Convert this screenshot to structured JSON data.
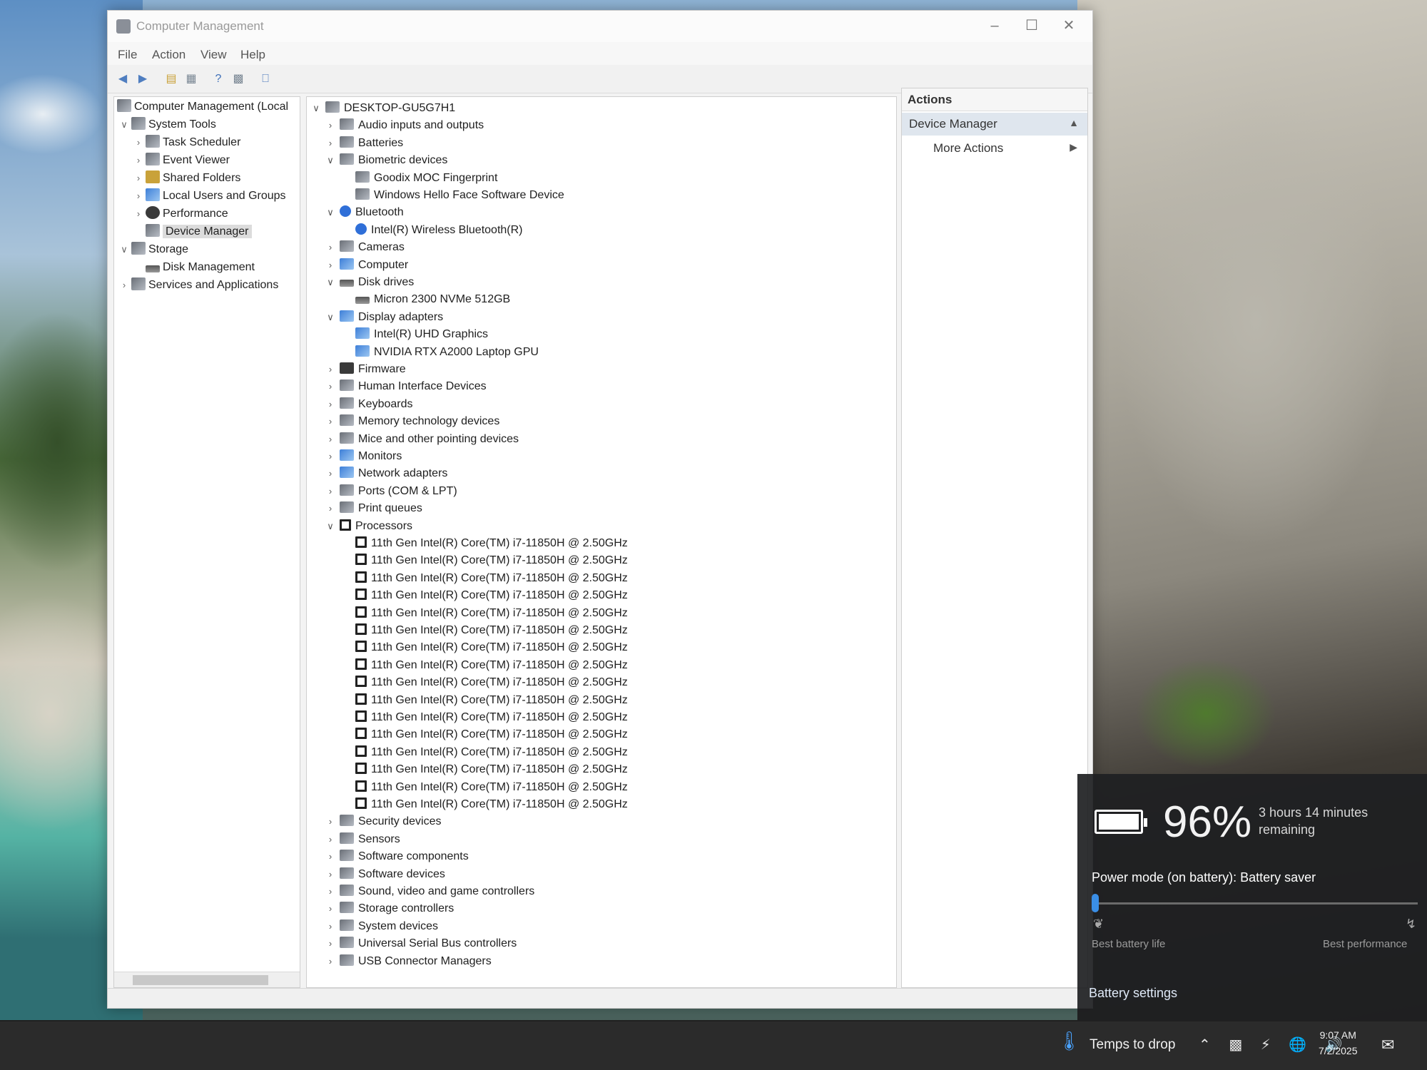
{
  "window": {
    "title": "Computer Management",
    "menu": [
      "File",
      "Action",
      "View",
      "Help"
    ]
  },
  "left_tree": [
    {
      "label": "Computer Management (Local",
      "expanded": true,
      "selected": false
    },
    {
      "label": "System Tools",
      "expanded": true,
      "selected": false
    },
    {
      "label": "Task Scheduler",
      "expanded": false,
      "selected": false
    },
    {
      "label": "Event Viewer",
      "expanded": false,
      "selected": false
    },
    {
      "label": "Shared Folders",
      "expanded": false,
      "selected": false
    },
    {
      "label": "Local Users and Groups",
      "expanded": false,
      "selected": false
    },
    {
      "label": "Performance",
      "expanded": false,
      "selected": false
    },
    {
      "label": "Device Manager",
      "expanded": false,
      "selected": true
    },
    {
      "label": "Storage",
      "expanded": true,
      "selected": false
    },
    {
      "label": "Disk Management",
      "expanded": false,
      "selected": false
    },
    {
      "label": "Services and Applications",
      "expanded": false,
      "selected": false
    }
  ],
  "device_tree": {
    "root": "DESKTOP-GU5G7H1",
    "categories": [
      {
        "label": "Audio inputs and outputs",
        "expanded": false,
        "icon": "speaker-icon",
        "children": []
      },
      {
        "label": "Batteries",
        "expanded": false,
        "icon": "battery-icon",
        "children": []
      },
      {
        "label": "Biometric devices",
        "expanded": true,
        "icon": "fingerprint-icon",
        "children": [
          "Goodix MOC Fingerprint",
          "Windows Hello Face Software Device"
        ]
      },
      {
        "label": "Bluetooth",
        "expanded": true,
        "icon": "bluetooth-icon",
        "children": [
          "Intel(R) Wireless Bluetooth(R)"
        ]
      },
      {
        "label": "Cameras",
        "expanded": false,
        "icon": "camera-icon",
        "children": []
      },
      {
        "label": "Computer",
        "expanded": false,
        "icon": "monitor-icon",
        "children": []
      },
      {
        "label": "Disk drives",
        "expanded": true,
        "icon": "disk-icon",
        "children": [
          "Micron 2300 NVMe 512GB"
        ]
      },
      {
        "label": "Display adapters",
        "expanded": true,
        "icon": "display-adapter-icon",
        "children": [
          "Intel(R) UHD Graphics",
          "NVIDIA RTX A2000 Laptop GPU"
        ]
      },
      {
        "label": "Firmware",
        "expanded": false,
        "icon": "firmware-icon",
        "children": []
      },
      {
        "label": "Human Interface Devices",
        "expanded": false,
        "icon": "hid-icon",
        "children": []
      },
      {
        "label": "Keyboards",
        "expanded": false,
        "icon": "keyboard-icon",
        "children": []
      },
      {
        "label": "Memory technology devices",
        "expanded": false,
        "icon": "memory-icon",
        "children": []
      },
      {
        "label": "Mice and other pointing devices",
        "expanded": false,
        "icon": "mouse-icon",
        "children": []
      },
      {
        "label": "Monitors",
        "expanded": false,
        "icon": "monitor-icon",
        "children": []
      },
      {
        "label": "Network adapters",
        "expanded": false,
        "icon": "network-icon",
        "children": []
      },
      {
        "label": "Ports (COM & LPT)",
        "expanded": false,
        "icon": "port-icon",
        "children": []
      },
      {
        "label": "Print queues",
        "expanded": false,
        "icon": "printer-icon",
        "children": []
      },
      {
        "label": "Processors",
        "expanded": true,
        "icon": "processor-icon",
        "children": [
          "11th Gen Intel(R) Core(TM) i7-11850H @ 2.50GHz",
          "11th Gen Intel(R) Core(TM) i7-11850H @ 2.50GHz",
          "11th Gen Intel(R) Core(TM) i7-11850H @ 2.50GHz",
          "11th Gen Intel(R) Core(TM) i7-11850H @ 2.50GHz",
          "11th Gen Intel(R) Core(TM) i7-11850H @ 2.50GHz",
          "11th Gen Intel(R) Core(TM) i7-11850H @ 2.50GHz",
          "11th Gen Intel(R) Core(TM) i7-11850H @ 2.50GHz",
          "11th Gen Intel(R) Core(TM) i7-11850H @ 2.50GHz",
          "11th Gen Intel(R) Core(TM) i7-11850H @ 2.50GHz",
          "11th Gen Intel(R) Core(TM) i7-11850H @ 2.50GHz",
          "11th Gen Intel(R) Core(TM) i7-11850H @ 2.50GHz",
          "11th Gen Intel(R) Core(TM) i7-11850H @ 2.50GHz",
          "11th Gen Intel(R) Core(TM) i7-11850H @ 2.50GHz",
          "11th Gen Intel(R) Core(TM) i7-11850H @ 2.50GHz",
          "11th Gen Intel(R) Core(TM) i7-11850H @ 2.50GHz",
          "11th Gen Intel(R) Core(TM) i7-11850H @ 2.50GHz"
        ]
      },
      {
        "label": "Security devices",
        "expanded": false,
        "icon": "security-icon",
        "children": []
      },
      {
        "label": "Sensors",
        "expanded": false,
        "icon": "sensor-icon",
        "children": []
      },
      {
        "label": "Software components",
        "expanded": false,
        "icon": "software-component-icon",
        "children": []
      },
      {
        "label": "Software devices",
        "expanded": false,
        "icon": "software-device-icon",
        "children": []
      },
      {
        "label": "Sound, video and game controllers",
        "expanded": false,
        "icon": "speaker-icon",
        "children": []
      },
      {
        "label": "Storage controllers",
        "expanded": false,
        "icon": "storage-controller-icon",
        "children": []
      },
      {
        "label": "System devices",
        "expanded": false,
        "icon": "system-icon",
        "children": []
      },
      {
        "label": "Universal Serial Bus controllers",
        "expanded": false,
        "icon": "usb-icon",
        "children": []
      },
      {
        "label": "USB Connector Managers",
        "expanded": false,
        "icon": "usb-icon",
        "children": []
      }
    ]
  },
  "actions": {
    "header": "Actions",
    "section": "Device Manager",
    "more": "More Actions"
  },
  "battery": {
    "percent": "96%",
    "level": 0.96,
    "remaining": "3 hours 14 minutes remaining",
    "power_mode": "Power mode (on battery): Battery saver",
    "slider_position": 0,
    "left_label": "Best battery life",
    "right_label": "Best performance",
    "settings_link": "Battery settings"
  },
  "taskbar": {
    "weather": "Temps to drop",
    "time": "9:07 AM",
    "date": "7/2/2025"
  },
  "colors": {
    "selection": "#dcdcdc",
    "actions_section_bg": "#dfe6ee",
    "flyout_bg": "#1e2022",
    "slider_accent": "#3a8ee6"
  }
}
